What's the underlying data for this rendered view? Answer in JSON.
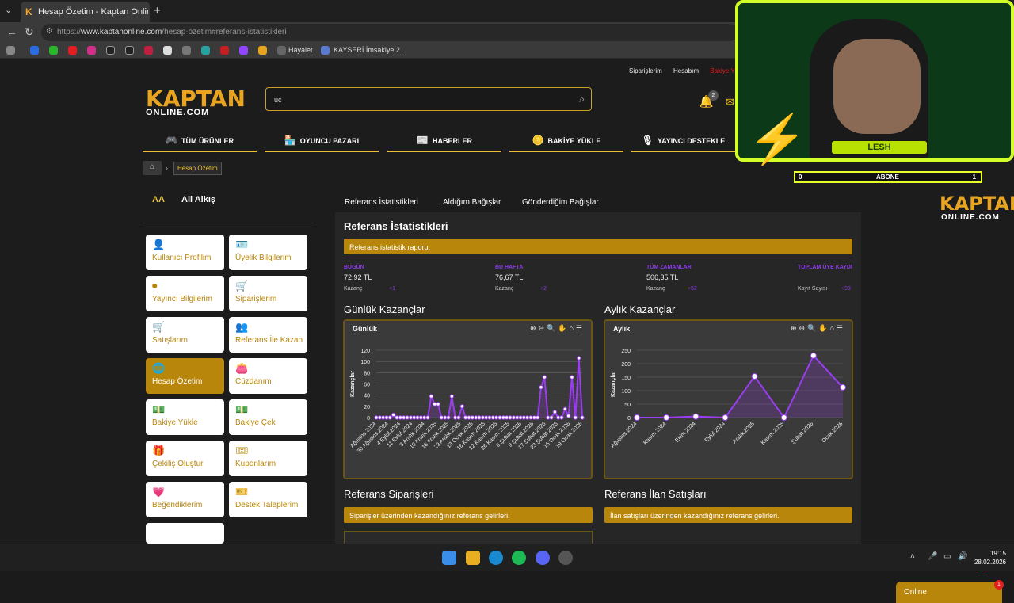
{
  "browser": {
    "tab_title": "Hesap Özetim - Kaptan Online",
    "url_prefix": "https://",
    "url_domain": "www.kaptanonline.com",
    "url_path": "/hesap-ozetim#referans-istatistikleri",
    "bookmarks": [
      "Hayalet",
      "KAYSERİ İmsakiye 2..."
    ]
  },
  "header": {
    "top_links": [
      "Siparişlerim",
      "Hesabım",
      "Bakiye Y"
    ],
    "logo_main": "KAPTAN",
    "logo_sub": "ONLINE.COM",
    "search_value": "uc",
    "bell_count": "2"
  },
  "menu": [
    {
      "label": "TÜM ÜRÜNLER",
      "icon": "gamepad-icon"
    },
    {
      "label": "OYUNCU PAZARI",
      "icon": "store-icon"
    },
    {
      "label": "HABERLER",
      "icon": "news-icon"
    },
    {
      "label": "BAKİYE YÜKLE",
      "icon": "coins-icon"
    },
    {
      "label": "YAYINCI DESTEKLE",
      "icon": "streamer-icon"
    }
  ],
  "breadcrumb": {
    "current": "Hesap Özetim"
  },
  "user": {
    "initials": "AA",
    "name": "Ali Alkış"
  },
  "sidebar_cards": [
    "Kullanıcı Profilim",
    "Üyelik Bilgilerim",
    "Yayıncı Bilgilerim",
    "Siparişlerim",
    "Satışlarım",
    "Referans İle Kazan",
    "Hesap Özetim",
    "Cüzdanım",
    "Bakiye Yükle",
    "Bakiye Çek",
    "Çekiliş Oluştur",
    "Kuponlarım",
    "Beğendiklerim",
    "Destek Taleplerim"
  ],
  "tabs": [
    "Referans İstatistikleri",
    "Aldığım Bağışlar",
    "Gönderdiğim Bağışlar"
  ],
  "panel": {
    "title": "Referans İstatistikleri",
    "banner": "Referans istatistik raporu.",
    "stats": [
      {
        "label": "BUGÜN",
        "value": "72,92 TL",
        "sub": "Kazanç",
        "plus": "+1"
      },
      {
        "label": "BU HAFTA",
        "value": "76,67 TL",
        "sub": "Kazanç",
        "plus": "+2"
      },
      {
        "label": "TÜM ZAMANLAR",
        "value": "506,35 TL",
        "sub": "Kazanç",
        "plus": "+52"
      },
      {
        "label": "TOPLAM ÜYE KAYDI",
        "value": "",
        "sub": "Kayıt Sayısı",
        "plus": "+99"
      }
    ],
    "daily_heading": "Günlük Kazançlar",
    "monthly_heading": "Aylık Kazançlar",
    "orders_heading": "Referans Siparişleri",
    "orders_banner": "Siparişler üzerinden kazandığınız referans gelirleri.",
    "listing_heading": "Referans İlan Satışları",
    "listing_banner": "İlan satışları üzerinden kazandığınız referans gelirleri."
  },
  "chart_data": [
    {
      "type": "area",
      "title": "Günlük",
      "ylabel": "Kazançlar",
      "ylim": [
        0,
        120
      ],
      "yticks": [
        0,
        20,
        40,
        60,
        80,
        100,
        120
      ],
      "xticklabels": [
        "Ağustos 2024",
        "30 Ağustos 2024",
        "4 Eylül 2024",
        "11 Eylül 2024",
        "3 Aralık 2024",
        "10 Aralık 2025",
        "16 Aralık 2025",
        "29 Aralık 2025",
        "13 Ocak 2025",
        "16 Kasım 2025",
        "12 Kasım 2025",
        "26 Kasım 2025",
        "6 Şubat 2026",
        "9 Şubat 2026",
        "17 Şubat 2026",
        "23 Şubat 2026",
        "16 Ocak 2026",
        "19 Ocak 2026"
      ],
      "values": [
        0,
        0,
        0,
        0,
        0,
        5,
        0,
        0,
        0,
        0,
        0,
        0,
        0,
        0,
        0,
        0,
        38,
        24,
        24,
        0,
        0,
        0,
        38,
        0,
        0,
        20,
        0,
        0,
        0,
        0,
        0,
        0,
        0,
        0,
        0,
        0,
        0,
        0,
        0,
        0,
        0,
        0,
        0,
        0,
        0,
        0,
        0,
        0,
        54,
        72,
        0,
        0,
        10,
        0,
        0,
        15,
        3,
        72,
        0,
        106,
        0
      ],
      "color": "#9b3df0"
    },
    {
      "type": "area",
      "title": "Aylık",
      "ylabel": "Kazançlar",
      "ylim": [
        0,
        250
      ],
      "yticks": [
        0,
        50,
        100,
        150,
        200,
        250
      ],
      "categories": [
        "Ağustos 2024",
        "Kasım 2024",
        "Ekim 2024",
        "Eylül 2024",
        "Aralık 2025",
        "Kasım 2025",
        "Şubat 2026",
        "Ocak 2026"
      ],
      "values": [
        0,
        0,
        4,
        0,
        153,
        0,
        230,
        112
      ],
      "color": "#9b3df0"
    }
  ],
  "overlay": {
    "streamer_name": "LESH",
    "sub_left": "0",
    "sub_label": "ABONE",
    "sub_right": "1",
    "logo_main": "KAPTAN",
    "logo_sub": "ONLINE.COM"
  },
  "chat": {
    "label": "Online",
    "badge": "1"
  },
  "taskbar": {
    "time": "19:15",
    "date": "28.02.2026"
  }
}
